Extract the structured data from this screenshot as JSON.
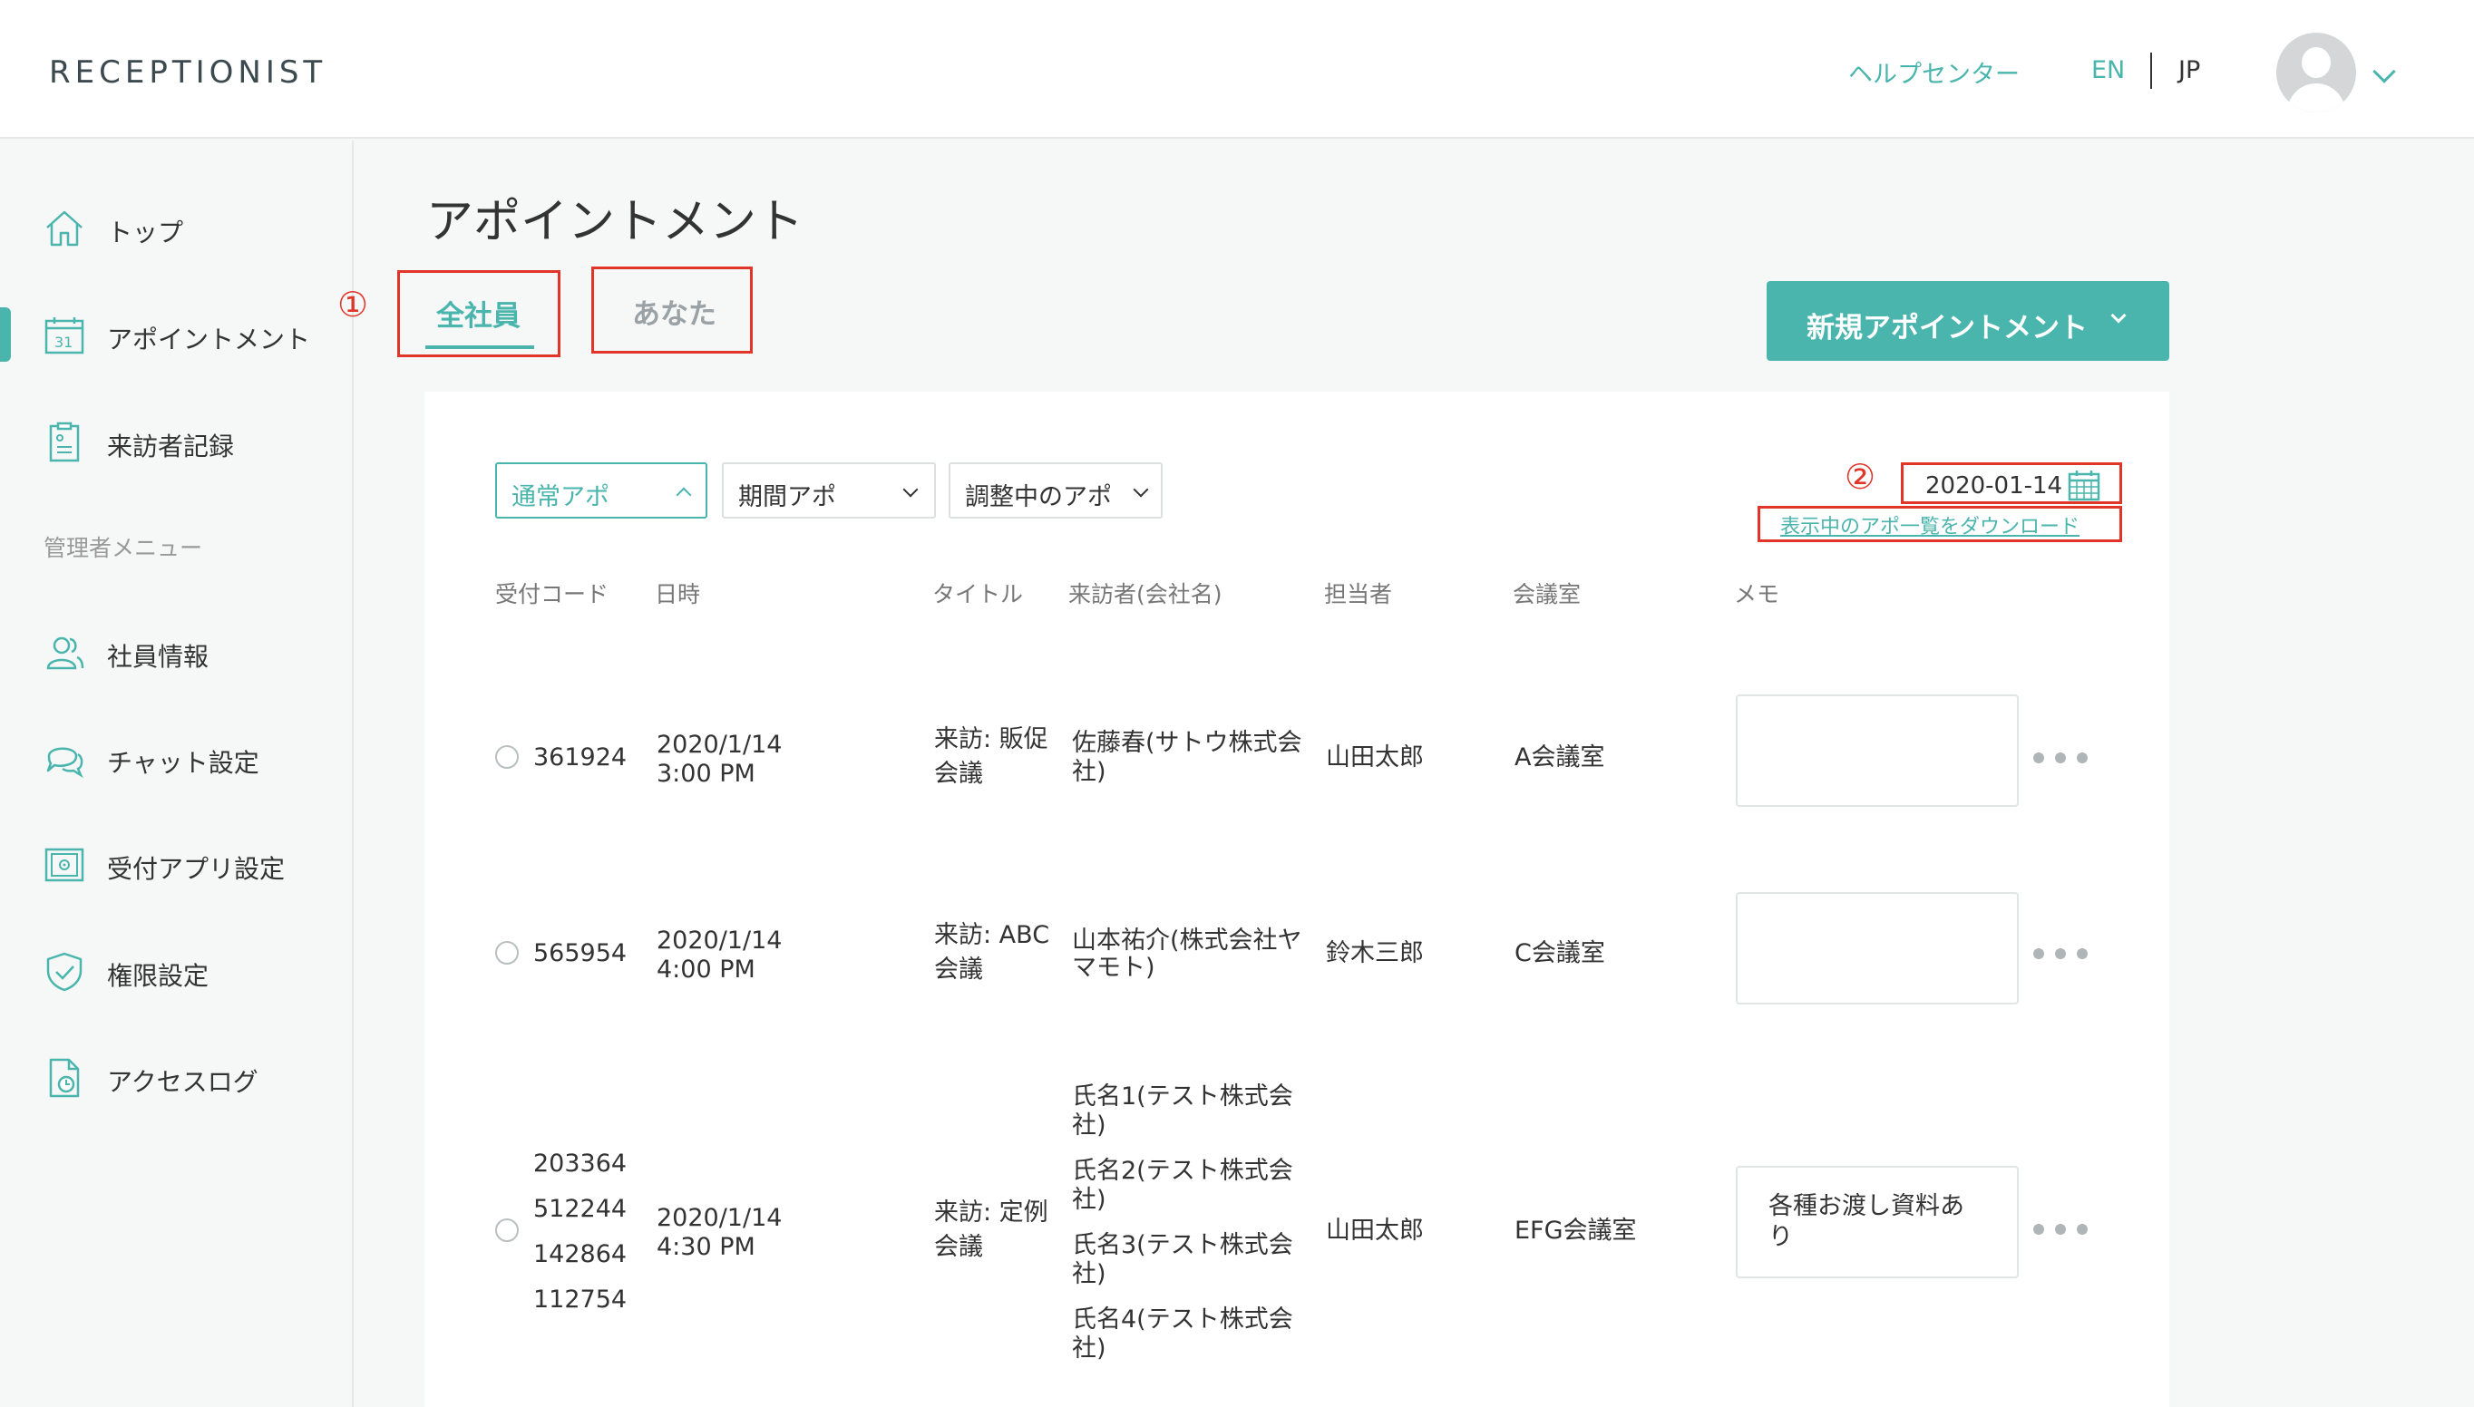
{
  "header": {
    "logo": "RECEPTIONIST",
    "help_center": "ヘルプセンター",
    "lang_en": "EN",
    "lang_jp": "JP"
  },
  "sidebar": {
    "items": [
      {
        "label": "トップ",
        "icon": "home-icon"
      },
      {
        "label": "アポイントメント",
        "icon": "calendar-icon",
        "active": true
      },
      {
        "label": "来訪者記録",
        "icon": "clipboard-icon"
      },
      {
        "label": "社員情報",
        "icon": "users-icon"
      },
      {
        "label": "チャット設定",
        "icon": "chat-icon"
      },
      {
        "label": "受付アプリ設定",
        "icon": "tablet-gear-icon"
      },
      {
        "label": "権限設定",
        "icon": "shield-check-icon"
      },
      {
        "label": "アクセスログ",
        "icon": "document-clock-icon"
      }
    ],
    "section_label": "管理者メニュー"
  },
  "main": {
    "title": "アポイントメント",
    "tabs": [
      {
        "label": "全社員",
        "active": true
      },
      {
        "label": "あなた",
        "active": false
      }
    ],
    "markers": {
      "one": "①",
      "two": "②"
    },
    "new_button": "新規アポイントメント",
    "filters": [
      {
        "label": "通常アポ",
        "active": true
      },
      {
        "label": "期間アポ",
        "active": false
      },
      {
        "label": "調整中のアポ",
        "active": false
      }
    ],
    "date": "2020-01-14",
    "download_link": "表示中のアポ一覧をダウンロード",
    "columns": [
      "受付コード",
      "日時",
      "タイトル",
      "来訪者(会社名)",
      "担当者",
      "会議室",
      "メモ"
    ],
    "rows": [
      {
        "codes": [
          "361924"
        ],
        "date": "2020/1/14",
        "time": "3:00 PM",
        "title_l1": "来訪: 販促",
        "title_l2": "会議",
        "visitors": [
          [
            "佐藤春(サトウ株式会",
            "社)"
          ]
        ],
        "host": "山田太郎",
        "room": "A会議室",
        "memo": ""
      },
      {
        "codes": [
          "565954"
        ],
        "date": "2020/1/14",
        "time": "4:00 PM",
        "title_l1": "来訪: ABC",
        "title_l2": "会議",
        "visitors": [
          [
            "山本祐介(株式会社ヤ",
            "マモト)"
          ]
        ],
        "host": "鈴木三郎",
        "room": "C会議室",
        "memo": ""
      },
      {
        "codes": [
          "203364",
          "512244",
          "142864",
          "112754"
        ],
        "date": "2020/1/14",
        "time": "4:30 PM",
        "title_l1": "来訪: 定例",
        "title_l2": "会議",
        "visitors": [
          [
            "氏名1(テスト株式会",
            "社)"
          ],
          [
            "氏名2(テスト株式会",
            "社)"
          ],
          [
            "氏名3(テスト株式会",
            "社)"
          ],
          [
            "氏名4(テスト株式会",
            "社)"
          ]
        ],
        "host": "山田太郎",
        "room": "EFG会議室",
        "memo_l1": "各種お渡し資料あ",
        "memo_l2": "り"
      }
    ]
  },
  "colors": {
    "accent": "#4ab5ad",
    "annotation_red": "#e1352a"
  }
}
